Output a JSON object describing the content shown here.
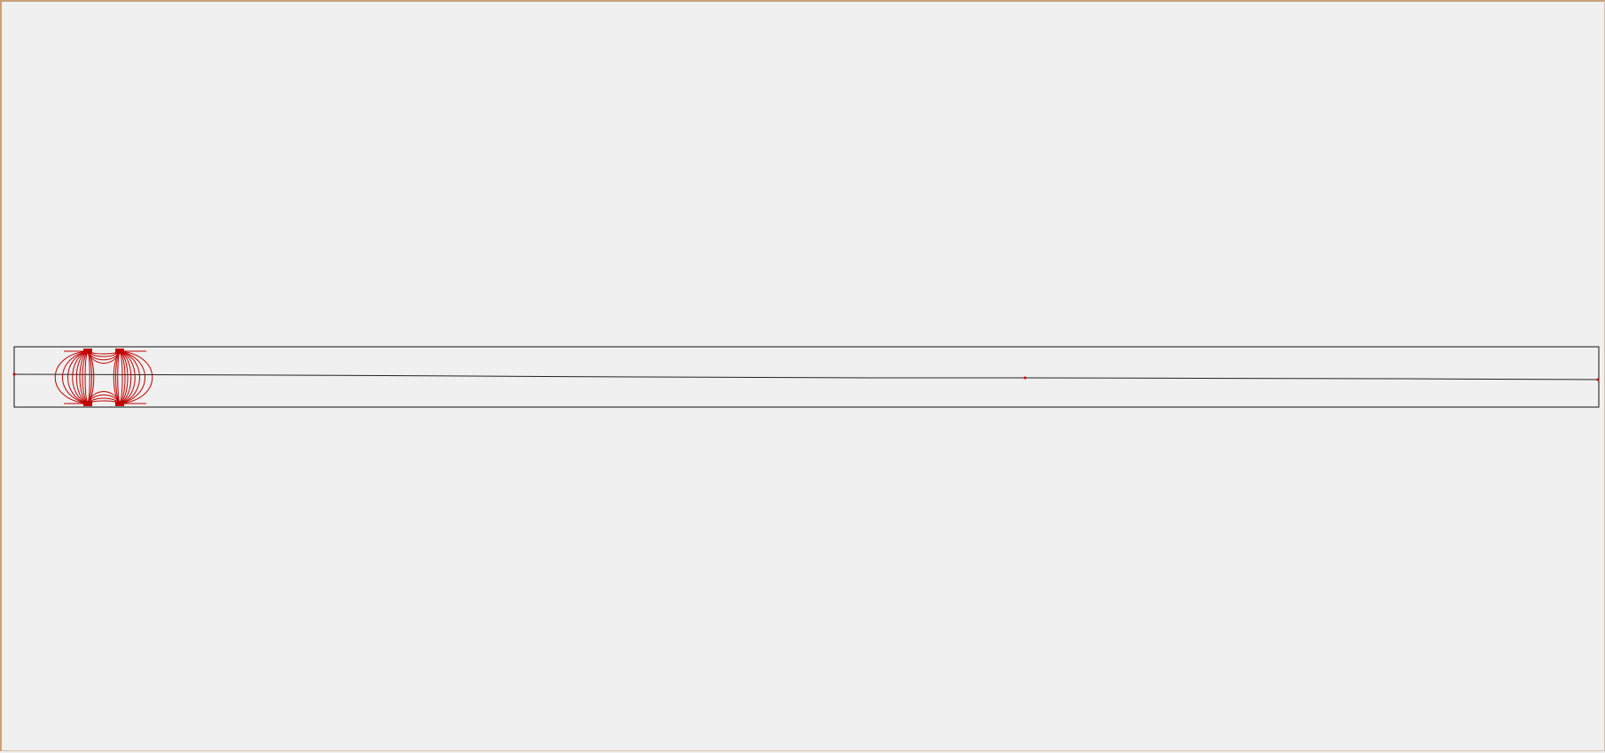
{
  "colors": {
    "background": "#f0f0f0",
    "frame": "#c8a078",
    "outline": "#111111",
    "field_lines": "#c00000"
  },
  "drawing": {
    "shapes": [
      "boundary-rectangle",
      "centerline",
      "field-line-cluster",
      "node-markers"
    ]
  }
}
